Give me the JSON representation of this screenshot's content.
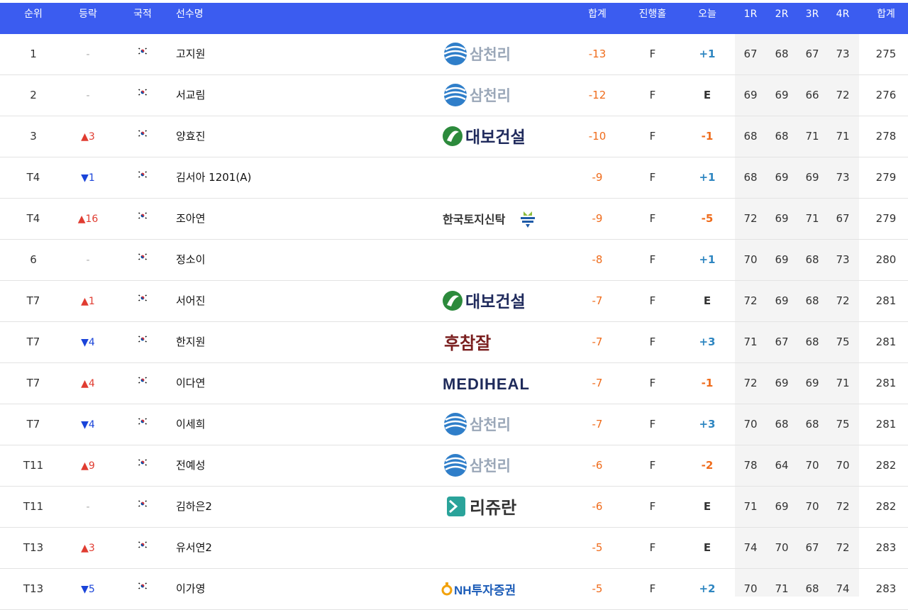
{
  "header": {
    "rank": "순위",
    "move": "등락",
    "nation": "국적",
    "player": "선수명",
    "total": "합계",
    "progress": "진행홀",
    "today": "오늘",
    "r1": "1R",
    "r2": "2R",
    "r3": "3R",
    "r4": "4R",
    "sum": "합계"
  },
  "colors": {
    "header_bg": "#3b5cf0",
    "up": "#e03c31",
    "down": "#1a44d9",
    "total": "#ef6c1c",
    "today_under": "#2e86c1"
  },
  "rows": [
    {
      "rank": "1",
      "move": "-",
      "dir": "none",
      "flag": "korea-flag-icon",
      "name": "고지원",
      "sponsor": "삼천리",
      "logo": "samchully",
      "total": "-13",
      "prog": "F",
      "today": "+1",
      "r1": "67",
      "r2": "68",
      "r3": "67",
      "r4": "73",
      "sum": "275"
    },
    {
      "rank": "2",
      "move": "-",
      "dir": "none",
      "flag": "korea-flag-icon",
      "name": "서교림",
      "sponsor": "삼천리",
      "logo": "samchully",
      "total": "-12",
      "prog": "F",
      "today": "E",
      "r1": "69",
      "r2": "69",
      "r3": "66",
      "r4": "72",
      "sum": "276"
    },
    {
      "rank": "3",
      "move": "▲3",
      "dir": "up",
      "flag": "korea-flag-icon",
      "name": "양효진",
      "sponsor": "대보건설",
      "logo": "daebo",
      "total": "-10",
      "prog": "F",
      "today": "-1",
      "r1": "68",
      "r2": "68",
      "r3": "71",
      "r4": "71",
      "sum": "278"
    },
    {
      "rank": "T4",
      "move": "▼1",
      "dir": "down",
      "flag": "korea-flag-icon",
      "name": "김서아 1201(A)",
      "sponsor": "",
      "logo": "",
      "total": "-9",
      "prog": "F",
      "today": "+1",
      "r1": "68",
      "r2": "69",
      "r3": "69",
      "r4": "73",
      "sum": "279"
    },
    {
      "rank": "T4",
      "move": "▲16",
      "dir": "up",
      "flag": "korea-flag-icon",
      "name": "조아연",
      "sponsor": "한국토지신탁",
      "logo": "koreit",
      "total": "-9",
      "prog": "F",
      "today": "-5",
      "r1": "72",
      "r2": "69",
      "r3": "71",
      "r4": "67",
      "sum": "279"
    },
    {
      "rank": "6",
      "move": "-",
      "dir": "none",
      "flag": "korea-flag-icon",
      "name": "정소이",
      "sponsor": "",
      "logo": "",
      "total": "-8",
      "prog": "F",
      "today": "+1",
      "r1": "70",
      "r2": "69",
      "r3": "68",
      "r4": "73",
      "sum": "280"
    },
    {
      "rank": "T7",
      "move": "▲1",
      "dir": "up",
      "flag": "korea-flag-icon",
      "name": "서어진",
      "sponsor": "대보건설",
      "logo": "daebo",
      "total": "-7",
      "prog": "F",
      "today": "E",
      "r1": "72",
      "r2": "69",
      "r3": "68",
      "r4": "72",
      "sum": "281"
    },
    {
      "rank": "T7",
      "move": "▼4",
      "dir": "down",
      "flag": "korea-flag-icon",
      "name": "한지원",
      "sponsor": "후참잘",
      "logo": "hochamjal",
      "total": "-7",
      "prog": "F",
      "today": "+3",
      "r1": "71",
      "r2": "67",
      "r3": "68",
      "r4": "75",
      "sum": "281"
    },
    {
      "rank": "T7",
      "move": "▲4",
      "dir": "up",
      "flag": "korea-flag-icon",
      "name": "이다연",
      "sponsor": "MEDIHEAL",
      "logo": "mediheal",
      "total": "-7",
      "prog": "F",
      "today": "-1",
      "r1": "72",
      "r2": "69",
      "r3": "69",
      "r4": "71",
      "sum": "281"
    },
    {
      "rank": "T7",
      "move": "▼4",
      "dir": "down",
      "flag": "korea-flag-icon",
      "name": "이세희",
      "sponsor": "삼천리",
      "logo": "samchully",
      "total": "-7",
      "prog": "F",
      "today": "+3",
      "r1": "70",
      "r2": "68",
      "r3": "68",
      "r4": "75",
      "sum": "281"
    },
    {
      "rank": "T11",
      "move": "▲9",
      "dir": "up",
      "flag": "korea-flag-icon",
      "name": "전예성",
      "sponsor": "삼천리",
      "logo": "samchully",
      "total": "-6",
      "prog": "F",
      "today": "-2",
      "r1": "78",
      "r2": "64",
      "r3": "70",
      "r4": "70",
      "sum": "282"
    },
    {
      "rank": "T11",
      "move": "-",
      "dir": "none",
      "flag": "korea-flag-icon",
      "name": "김하은2",
      "sponsor": "리쥬란",
      "logo": "rejuran",
      "total": "-6",
      "prog": "F",
      "today": "E",
      "r1": "71",
      "r2": "69",
      "r3": "70",
      "r4": "72",
      "sum": "282"
    },
    {
      "rank": "T13",
      "move": "▲3",
      "dir": "up",
      "flag": "korea-flag-icon",
      "name": "유서연2",
      "sponsor": "",
      "logo": "",
      "total": "-5",
      "prog": "F",
      "today": "E",
      "r1": "74",
      "r2": "70",
      "r3": "67",
      "r4": "72",
      "sum": "283"
    },
    {
      "rank": "T13",
      "move": "▼5",
      "dir": "down",
      "flag": "korea-flag-icon",
      "name": "이가영",
      "sponsor": "NH투자증권",
      "logo": "nh",
      "total": "-5",
      "prog": "F",
      "today": "+2",
      "r1": "70",
      "r2": "71",
      "r3": "68",
      "r4": "74",
      "sum": "283"
    }
  ]
}
